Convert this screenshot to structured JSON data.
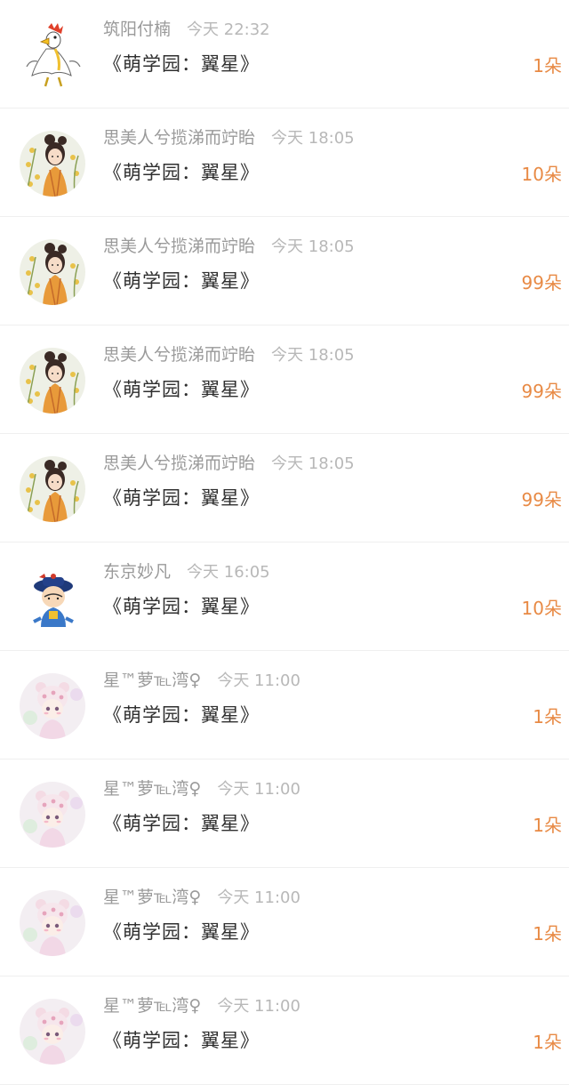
{
  "entries": [
    {
      "name": "筑阳付楠",
      "time": "今天 22:32",
      "gift": "《萌学园：翼星》",
      "count": "1朵",
      "avatar": "rooster-avatar"
    },
    {
      "name": "思美人兮揽涕而竚眙",
      "time": "今天 18:05",
      "gift": "《萌学园：翼星》",
      "count": "10朵",
      "avatar": "girl-flowers-avatar"
    },
    {
      "name": "思美人兮揽涕而竚眙",
      "time": "今天 18:05",
      "gift": "《萌学园：翼星》",
      "count": "99朵",
      "avatar": "girl-flowers-avatar"
    },
    {
      "name": "思美人兮揽涕而竚眙",
      "time": "今天 18:05",
      "gift": "《萌学园：翼星》",
      "count": "99朵",
      "avatar": "girl-flowers-avatar"
    },
    {
      "name": "思美人兮揽涕而竚眙",
      "time": "今天 18:05",
      "gift": "《萌学园：翼星》",
      "count": "99朵",
      "avatar": "girl-flowers-avatar"
    },
    {
      "name": "东京妙凡",
      "time": "今天 16:05",
      "gift": "《萌学园：翼星》",
      "count": "10朵",
      "avatar": "qing-official-avatar"
    },
    {
      "name": "星™萝℡湾♀",
      "time": "今天 11:00",
      "gift": "《萌学园：翼星》",
      "count": "1朵",
      "avatar": "bear-hat-girl-avatar"
    },
    {
      "name": "星™萝℡湾♀",
      "time": "今天 11:00",
      "gift": "《萌学园：翼星》",
      "count": "1朵",
      "avatar": "bear-hat-girl-avatar"
    },
    {
      "name": "星™萝℡湾♀",
      "time": "今天 11:00",
      "gift": "《萌学园：翼星》",
      "count": "1朵",
      "avatar": "bear-hat-girl-avatar"
    },
    {
      "name": "星™萝℡湾♀",
      "time": "今天 11:00",
      "gift": "《萌学园：翼星》",
      "count": "1朵",
      "avatar": "bear-hat-girl-avatar"
    }
  ],
  "colors": {
    "name": "#9a9a9a",
    "time": "#b8b8b8",
    "gift": "#2f2f2f",
    "count": "#e88a45"
  }
}
